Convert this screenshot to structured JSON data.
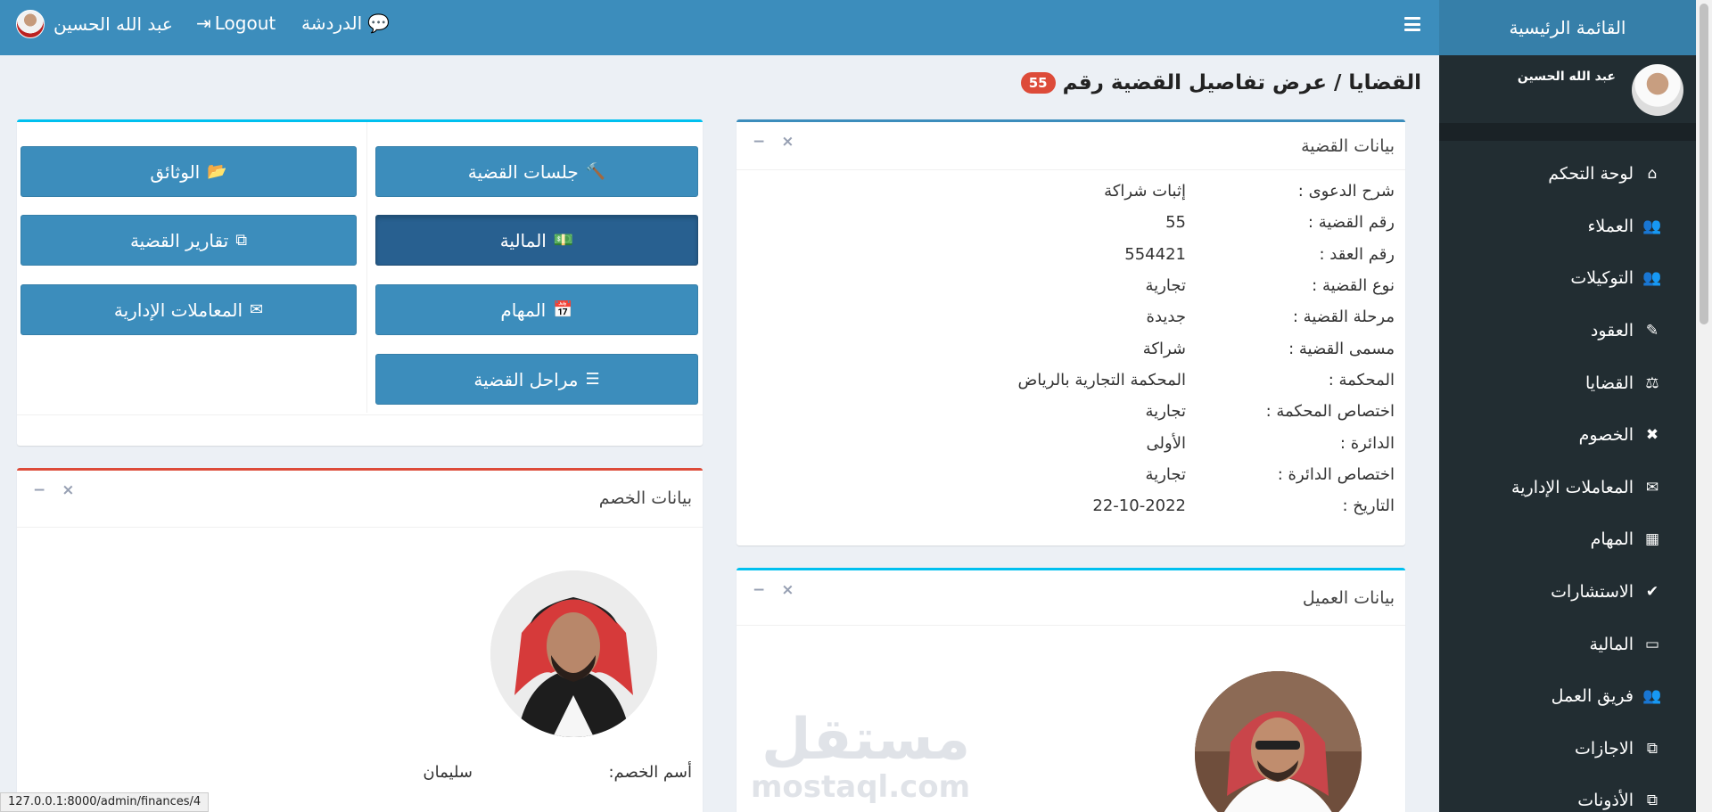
{
  "topbar": {
    "user_name": "عبد الله الحسين",
    "logout_label": "Logout",
    "chat_label": "الدردشة"
  },
  "sidebar": {
    "brand": "القائمة الرئيسية",
    "profile_name": "عبد الله الحسين",
    "items": [
      {
        "label": "لوحة التحكم",
        "icon": "home-icon",
        "glyph": "⌂"
      },
      {
        "label": "العملاء",
        "icon": "users-icon",
        "glyph": "👥"
      },
      {
        "label": "التوكيلات",
        "icon": "users-icon",
        "glyph": "👥"
      },
      {
        "label": "العقود",
        "icon": "edit-icon",
        "glyph": "✎"
      },
      {
        "label": "القضايا",
        "icon": "balance-scale-icon",
        "glyph": "⚖"
      },
      {
        "label": "الخصوم",
        "icon": "user-times-icon",
        "glyph": "✖"
      },
      {
        "label": "المعاملات الإدارية",
        "icon": "envelope-icon",
        "glyph": "✉"
      },
      {
        "label": "المهام",
        "icon": "calendar-icon",
        "glyph": "▦"
      },
      {
        "label": "الاستشارات",
        "icon": "check-icon",
        "glyph": "✔"
      },
      {
        "label": "المالية",
        "icon": "money-icon",
        "glyph": "▭"
      },
      {
        "label": "فريق العمل",
        "icon": "users-icon",
        "glyph": "👥"
      },
      {
        "label": "الاجازات",
        "icon": "copy-icon",
        "glyph": "⧉"
      },
      {
        "label": "الأذونات",
        "icon": "copy-icon",
        "glyph": "⧉"
      }
    ]
  },
  "page": {
    "title": "القضايا / عرض تفاصيل القضية رقم",
    "case_number_badge": "55"
  },
  "case_box": {
    "title": "بيانات القضية",
    "rows": [
      {
        "label": "شرح الدعوى :",
        "value": "إثبات شراكة"
      },
      {
        "label": "رقم القضية :",
        "value": "55"
      },
      {
        "label": "رقم العقد :",
        "value": "554421"
      },
      {
        "label": "نوع القضية :",
        "value": "تجارية"
      },
      {
        "label": "مرحلة القضية :",
        "value": "جديدة"
      },
      {
        "label": "مسمى القضية :",
        "value": "شراكة"
      },
      {
        "label": "المحكمة :",
        "value": "المحكمة التجارية بالرياض"
      },
      {
        "label": "اختصاص المحكمة :",
        "value": "تجارية"
      },
      {
        "label": "الدائرة :",
        "value": "الأولى"
      },
      {
        "label": "اختصاص الدائرة :",
        "value": "تجارية"
      },
      {
        "label": "التاريخ :",
        "value": "22-10-2022"
      }
    ]
  },
  "actions": {
    "sessions": "جلسات القضية",
    "documents": "الوثائق",
    "finance": "المالية",
    "reports": "تقارير القضية",
    "tasks": "المهام",
    "admin": "المعاملات الإدارية",
    "stages": "مراحل القضية"
  },
  "opponent_box": {
    "title": "بيانات الخصم",
    "name_label": "أسم الخصم:",
    "name_value": "سليمان"
  },
  "client_box": {
    "title": "بيانات العميل"
  },
  "watermark": {
    "arabic": "مستقل",
    "latin": "mostaql.com"
  },
  "status_url": "127.0.0.1:8000/admin/finances/4",
  "box_tools": {
    "minimize": "−",
    "close": "×"
  }
}
